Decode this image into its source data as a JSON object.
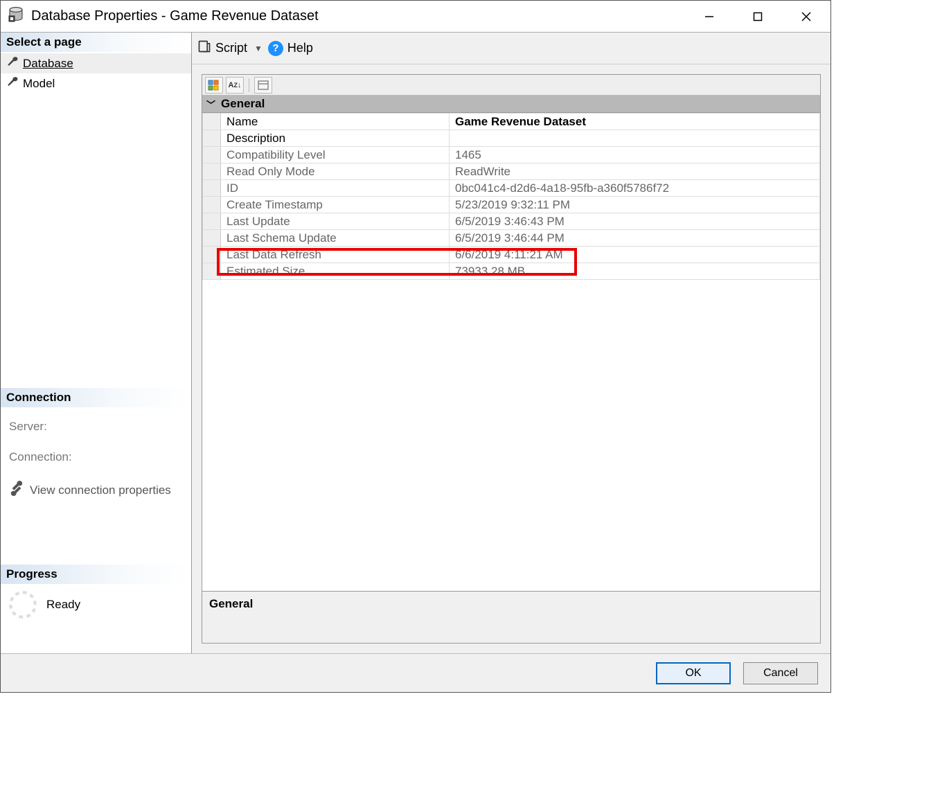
{
  "window": {
    "title": "Database Properties - Game Revenue Dataset"
  },
  "sidebar": {
    "select_header": "Select a page",
    "items": [
      {
        "label": "Database",
        "selected": true
      },
      {
        "label": "Model",
        "selected": false
      }
    ],
    "connection_header": "Connection",
    "server_label": "Server:",
    "connection_label": "Connection:",
    "view_conn_props": "View connection properties",
    "progress_header": "Progress",
    "progress_status": "Ready"
  },
  "toolbar": {
    "script_label": "Script",
    "help_label": "Help"
  },
  "propgrid": {
    "group_label": "General",
    "rows": [
      {
        "name": "Name",
        "value": "Game Revenue Dataset",
        "editable": true,
        "boldValue": true
      },
      {
        "name": "Description",
        "value": "",
        "editable": true
      },
      {
        "name": "Compatibility Level",
        "value": "1465",
        "editable": false
      },
      {
        "name": "Read Only Mode",
        "value": "ReadWrite",
        "editable": false
      },
      {
        "name": "ID",
        "value": "0bc041c4-d2d6-4a18-95fb-a360f5786f72",
        "editable": false
      },
      {
        "name": "Create Timestamp",
        "value": "5/23/2019 9:32:11 PM",
        "editable": false
      },
      {
        "name": "Last Update",
        "value": "6/5/2019 3:46:43 PM",
        "editable": false
      },
      {
        "name": "Last Schema Update",
        "value": "6/5/2019 3:46:44 PM",
        "editable": false
      },
      {
        "name": "Last Data Refresh",
        "value": "6/6/2019 4:11:21 AM",
        "editable": false
      },
      {
        "name": "Estimated Size",
        "value": "73933.28 MB",
        "editable": false,
        "highlight": true
      }
    ],
    "desc_label": "General"
  },
  "footer": {
    "ok": "OK",
    "cancel": "Cancel"
  }
}
